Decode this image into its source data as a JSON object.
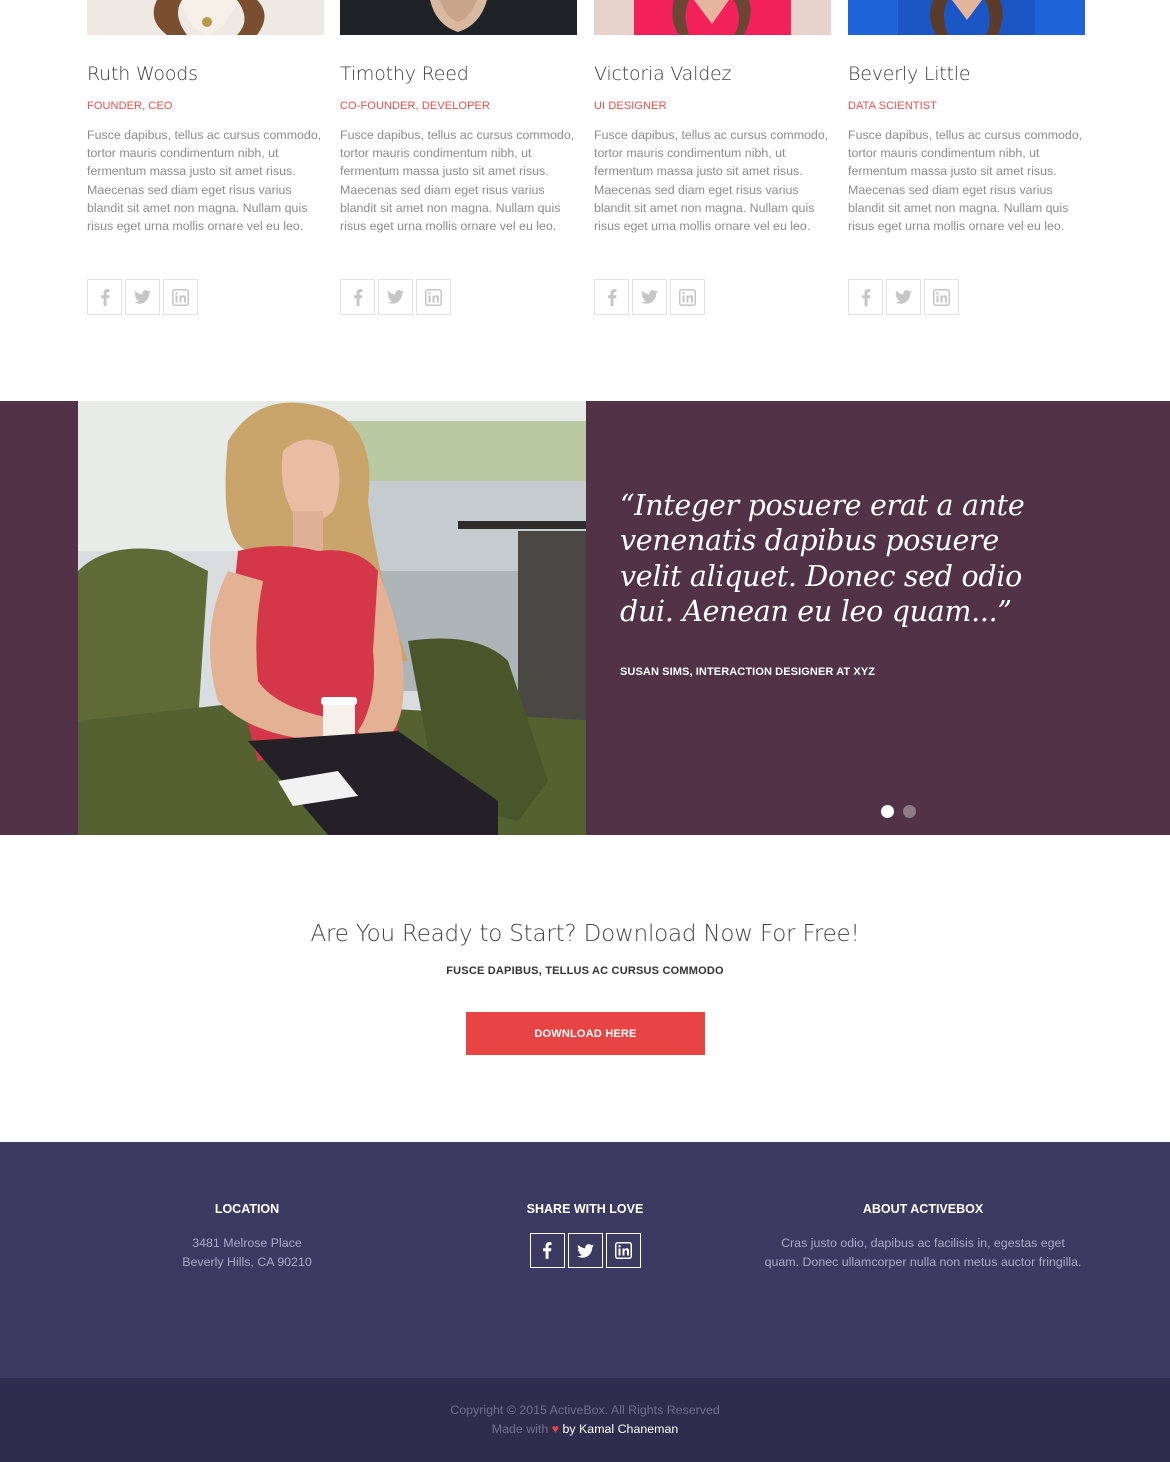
{
  "team": {
    "members": [
      {
        "name": "Ruth Woods",
        "role": "FOUNDER, CEO",
        "bio": "Fusce dapibus, tellus ac cursus commodo, tortor mauris condimentum nibh, ut fermentum massa justo sit amet risus. Maecenas sed diam eget risus varius blandit sit amet non magna. Nullam quis risus eget urna mollis ornare vel eu leo."
      },
      {
        "name": "Timothy Reed",
        "role": "CO-FOUNDER, DEVELOPER",
        "bio": "Fusce dapibus, tellus ac cursus commodo, tortor mauris condimentum nibh, ut fermentum massa justo sit amet risus. Maecenas sed diam eget risus varius blandit sit amet non magna. Nullam quis risus eget urna mollis ornare vel eu leo."
      },
      {
        "name": "Victoria Valdez",
        "role": "UI DESIGNER",
        "bio": "Fusce dapibus, tellus ac cursus commodo, tortor mauris condimentum nibh, ut fermentum massa justo sit amet risus. Maecenas sed diam eget risus varius blandit sit amet non magna. Nullam quis risus eget urna mollis ornare vel eu leo."
      },
      {
        "name": "Beverly Little",
        "role": "DATA SCIENTIST",
        "bio": "Fusce dapibus, tellus ac cursus commodo, tortor mauris condimentum nibh, ut fermentum massa justo sit amet risus. Maecenas sed diam eget risus varius blandit sit amet non magna. Nullam quis risus eget urna mollis ornare vel eu leo."
      }
    ],
    "social_icons": [
      "facebook-icon",
      "twitter-icon",
      "linkedin-icon"
    ]
  },
  "testimonial": {
    "quote": "“Integer posuere erat a ante venenatis dapibus posuere velit aliquet. Donec sed odio dui. Aenean eu leo quam...”",
    "author": "SUSAN SIMS, INTERACTION DESIGNER AT XYZ",
    "slide_count": 2,
    "active_slide": 1,
    "background_color": "#523247"
  },
  "cta": {
    "title": "Are You Ready to Start? Download Now For Free!",
    "subtitle": "FUSCE DAPIBUS, TELLUS AC CURSUS COMMODO",
    "button_label": "DOWNLOAD HERE",
    "button_color": "#e84444"
  },
  "footer": {
    "location": {
      "heading": "LOCATION",
      "line1": "3481 Melrose Place",
      "line2": "Beverly Hills, CA 90210"
    },
    "share": {
      "heading": "SHARE WITH LOVE",
      "icons": [
        "facebook-icon",
        "twitter-icon",
        "linkedin-icon"
      ]
    },
    "about": {
      "heading": "ABOUT ACTIVEBOX",
      "text": "Cras justo odio, dapibus ac facilisis in, egestas eget quam. Donec ullamcorper nulla non metus auctor fringilla."
    },
    "background_color": "#3b3b62"
  },
  "copyright": {
    "line1": "Copyright © 2015 ActiveBox. All Rights Reserved",
    "made_with": "Made with",
    "heart": "♥",
    "by": "by Kamal Chaneman"
  }
}
